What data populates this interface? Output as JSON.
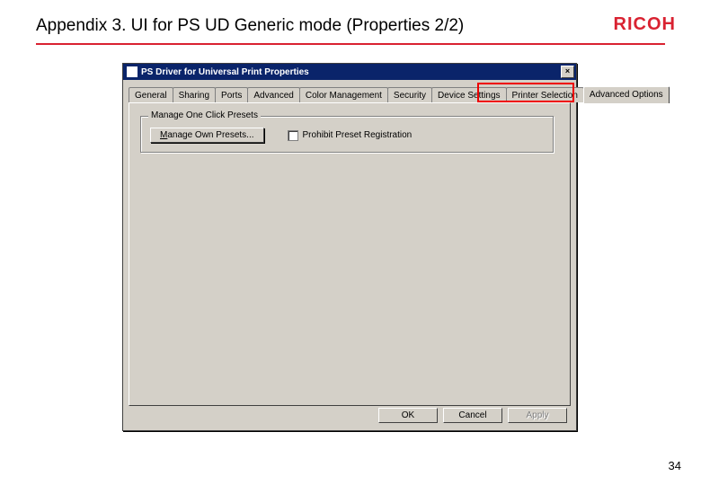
{
  "slide": {
    "title": "Appendix 3. UI for PS UD Generic mode (Properties 2/2)",
    "brand": "RICOH",
    "page_number": "34"
  },
  "dialog": {
    "title": "PS Driver for Universal Print Properties",
    "close_glyph": "×",
    "tabs": [
      {
        "label": "General"
      },
      {
        "label": "Sharing"
      },
      {
        "label": "Ports"
      },
      {
        "label": "Advanced"
      },
      {
        "label": "Color Management"
      },
      {
        "label": "Security"
      },
      {
        "label": "Device Settings"
      },
      {
        "label": "Printer Selection"
      },
      {
        "label": "Advanced Options"
      }
    ],
    "active_tab_index": 8,
    "group": {
      "title": "Manage One Click Presets",
      "button_label": "Manage Own Presets...",
      "checkbox_label": "Prohibit Preset Registration"
    },
    "buttons": {
      "ok": "OK",
      "cancel": "Cancel",
      "apply": "Apply"
    }
  }
}
